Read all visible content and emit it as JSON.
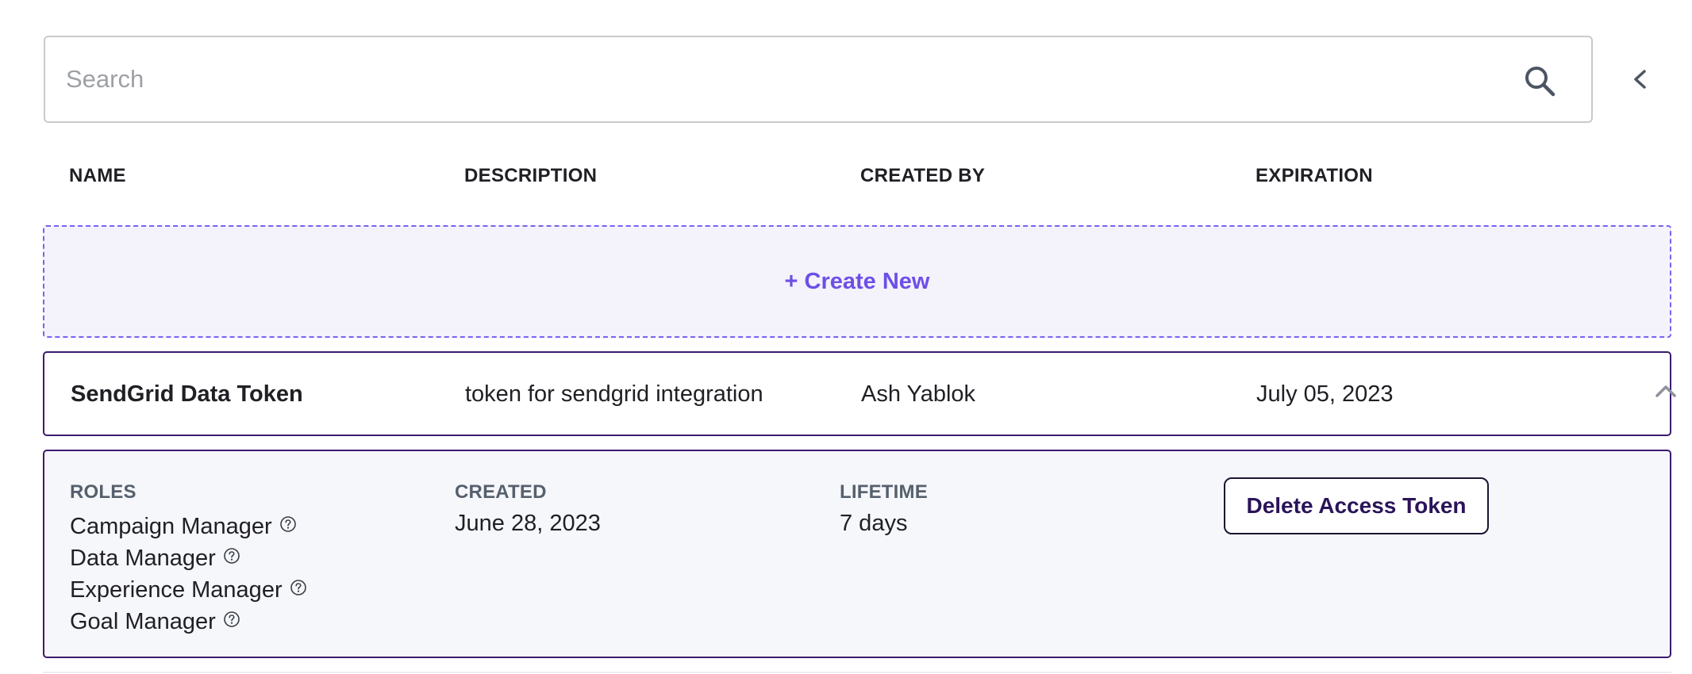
{
  "search": {
    "placeholder": "Search",
    "value": ""
  },
  "table": {
    "columns": [
      "NAME",
      "DESCRIPTION",
      "CREATED BY",
      "EXPIRATION"
    ]
  },
  "create_new": {
    "label": "+ Create New"
  },
  "tokens": [
    {
      "name": "SendGrid Data Token",
      "description": "token for sendgrid integration",
      "created_by": "Ash Yablok",
      "expiration": "July 05, 2023",
      "expanded": true,
      "details": {
        "roles_label": "ROLES",
        "roles": [
          "Campaign Manager",
          "Data Manager",
          "Experience Manager",
          "Goal Manager"
        ],
        "created_label": "CREATED",
        "created": "June 28, 2023",
        "lifetime_label": "LIFETIME",
        "lifetime": "7 days",
        "delete_label": "Delete Access Token"
      }
    }
  ],
  "colors": {
    "accent": "#6d4fe6",
    "accent_border": "#7b61f1",
    "row_border": "#3c1a6e",
    "create_bg": "#f4f2fb",
    "details_bg": "#f6f7fb",
    "label_gray": "#56606d"
  },
  "icons": {
    "search": "search-icon",
    "collapse": "chevron-left-icon",
    "row_toggle": "chevron-up-icon",
    "role_help": "help-circle-icon"
  }
}
